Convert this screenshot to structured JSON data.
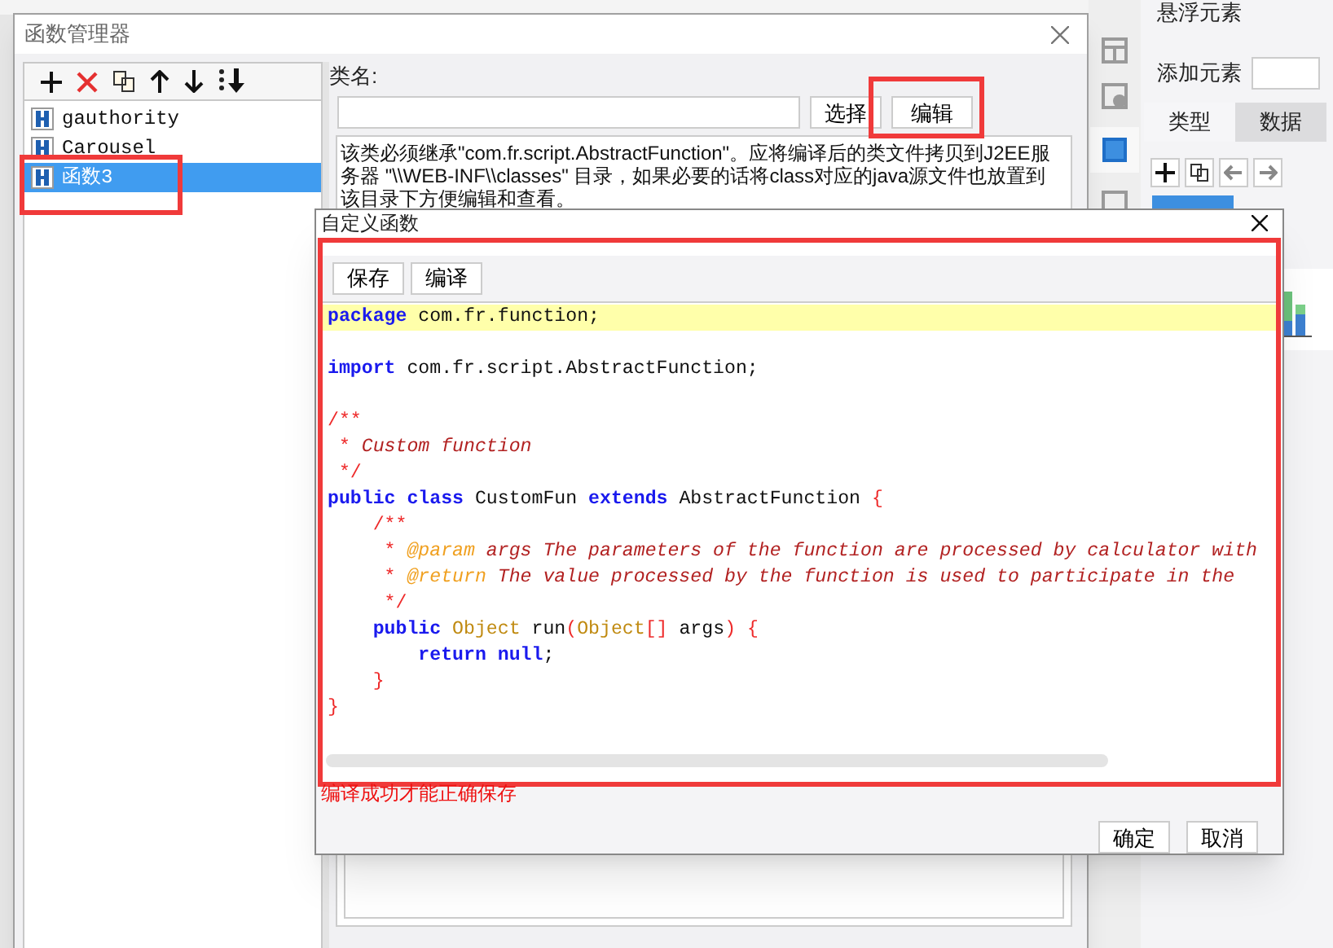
{
  "side_panel": {
    "title": "悬浮元素",
    "add_label": "添加元素",
    "tabs": [
      {
        "label": "类型",
        "selected": true
      },
      {
        "label": "数据",
        "selected": false
      }
    ]
  },
  "function_manager": {
    "title": "函数管理器",
    "functions": [
      {
        "name": "gauthority",
        "selected": false
      },
      {
        "name": "Carousel",
        "selected": false
      },
      {
        "name": "函数3",
        "selected": true
      }
    ],
    "class_label": "类名:",
    "select_button": "选择",
    "edit_button": "编辑",
    "description": "该类必须继承\"com.fr.script.AbstractFunction\"。应将编译后的类文件拷贝到J2EE服务器 \"\\\\WEB-INF\\\\classes\" 目录，如果必要的话将class对应的java源文件也放置到该目录下方便编辑和查看。"
  },
  "custom_function": {
    "title": "自定义函数",
    "toolbar_buttons": [
      "保存",
      "编译"
    ],
    "code_lines": [
      {
        "highlighted": true,
        "tokens": [
          {
            "kind": "keyword",
            "text": "package"
          },
          {
            "kind": "plain",
            "text": " com.fr.function;"
          }
        ]
      },
      {
        "highlighted": false
      },
      {
        "highlighted": false,
        "tokens": [
          {
            "kind": "keyword",
            "text": "import"
          },
          {
            "kind": "plain",
            "text": " com.fr.script.AbstractFunction;"
          }
        ]
      },
      {
        "highlighted": false
      },
      {
        "highlighted": false,
        "tokens": [
          {
            "kind": "comment_mark",
            "text": "/**"
          }
        ]
      },
      {
        "highlighted": false,
        "tokens": [
          {
            "kind": "comment_mark",
            "text": " * "
          },
          {
            "kind": "comment_text",
            "text": "Custom function"
          }
        ]
      },
      {
        "highlighted": false,
        "tokens": [
          {
            "kind": "comment_mark",
            "text": " */"
          }
        ]
      },
      {
        "highlighted": false,
        "tokens": [
          {
            "kind": "keyword",
            "text": "public"
          },
          {
            "kind": "keyword",
            "text": " class"
          },
          {
            "kind": "plain",
            "text": " CustomFun "
          },
          {
            "kind": "keyword",
            "text": "extends"
          },
          {
            "kind": "plain",
            "text": " AbstractFunction "
          },
          {
            "kind": "brace",
            "text": "{"
          }
        ]
      },
      {
        "highlighted": false,
        "tokens": [
          {
            "kind": "comment_mark",
            "text": "    /**"
          }
        ]
      },
      {
        "highlighted": false,
        "tokens": [
          {
            "kind": "comment_mark",
            "text": "     * "
          },
          {
            "kind": "doc_tag",
            "text": "@param"
          },
          {
            "kind": "comment_text",
            "text": " args The parameters of the function are processed by calculator with"
          }
        ]
      },
      {
        "highlighted": false,
        "tokens": [
          {
            "kind": "comment_mark",
            "text": "     * "
          },
          {
            "kind": "doc_tag",
            "text": "@return"
          },
          {
            "kind": "comment_text",
            "text": " The value processed by the function is used to participate in the"
          }
        ]
      },
      {
        "highlighted": false,
        "tokens": [
          {
            "kind": "comment_mark",
            "text": "     */"
          }
        ]
      },
      {
        "highlighted": false,
        "tokens": [
          {
            "kind": "keyword",
            "text": "    public"
          },
          {
            "kind": "type",
            "text": " Object"
          },
          {
            "kind": "plain",
            "text": " run"
          },
          {
            "kind": "brace",
            "text": "("
          },
          {
            "kind": "type",
            "text": "Object"
          },
          {
            "kind": "brace",
            "text": "[]"
          },
          {
            "kind": "plain",
            "text": " args"
          },
          {
            "kind": "brace",
            "text": ")"
          },
          {
            "kind": "brace",
            "text": " {"
          }
        ]
      },
      {
        "highlighted": false,
        "tokens": [
          {
            "kind": "keyword",
            "text": "        return"
          },
          {
            "kind": "keyword",
            "text": " null"
          },
          {
            "kind": "plain",
            "text": ";"
          }
        ]
      },
      {
        "highlighted": false,
        "tokens": [
          {
            "kind": "brace",
            "text": "    }"
          }
        ]
      },
      {
        "highlighted": false,
        "tokens": [
          {
            "kind": "brace",
            "text": "}"
          }
        ]
      }
    ],
    "status": "编译成功才能正确保存",
    "footer_buttons": [
      "确定",
      "取消"
    ]
  }
}
